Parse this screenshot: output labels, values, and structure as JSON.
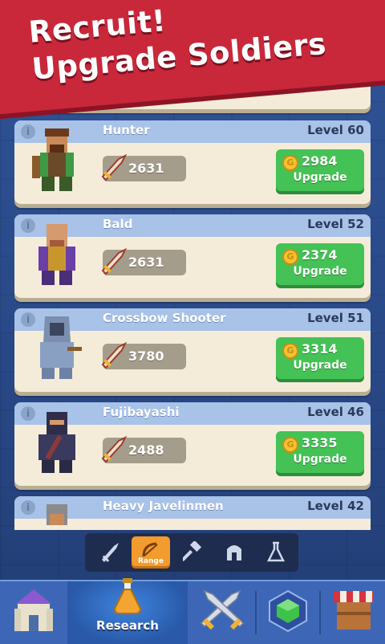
{
  "banner": {
    "line1": "Recruit!",
    "line2": "Upgrade Soldiers"
  },
  "colors": {
    "banner": "#c8283a",
    "card_header": "#a8c2e8",
    "upgrade_button": "#44c255",
    "active_tab": "#f29b2e",
    "nav": "#3d67b6"
  },
  "soldiers": [
    {
      "name": "Hunter",
      "level": "Level 60",
      "power": "2631",
      "cost": "2984",
      "upgrade": "Upgrade",
      "icon": "hunter-portrait"
    },
    {
      "name": "Bald",
      "level": "Level 52",
      "power": "2631",
      "cost": "2374",
      "upgrade": "Upgrade",
      "icon": "bald-portrait"
    },
    {
      "name": "Crossbow Shooter",
      "level": "Level 51",
      "power": "3780",
      "cost": "3314",
      "upgrade": "Upgrade",
      "icon": "crossbow-shooter-portrait"
    },
    {
      "name": "Fujibayashi",
      "level": "Level 46",
      "power": "2488",
      "cost": "3335",
      "upgrade": "Upgrade",
      "icon": "ninja-portrait"
    },
    {
      "name": "Heavy Javelinmen",
      "level": "Level 42",
      "icon": "javelinmen-portrait"
    }
  ],
  "filters": [
    {
      "icon": "sword-icon"
    },
    {
      "icon": "bow-icon",
      "label": "Range",
      "active": true
    },
    {
      "icon": "hammer-icon"
    },
    {
      "icon": "helmet-icon"
    },
    {
      "icon": "flask-icon"
    }
  ],
  "nav": {
    "castle": {
      "icon": "castle-icon"
    },
    "research": {
      "icon": "potion-icon",
      "label": "Research",
      "active": true
    },
    "battle": {
      "icon": "crossed-swords-icon"
    },
    "gems": {
      "icon": "gem-icon"
    },
    "shop": {
      "icon": "shop-icon"
    }
  }
}
